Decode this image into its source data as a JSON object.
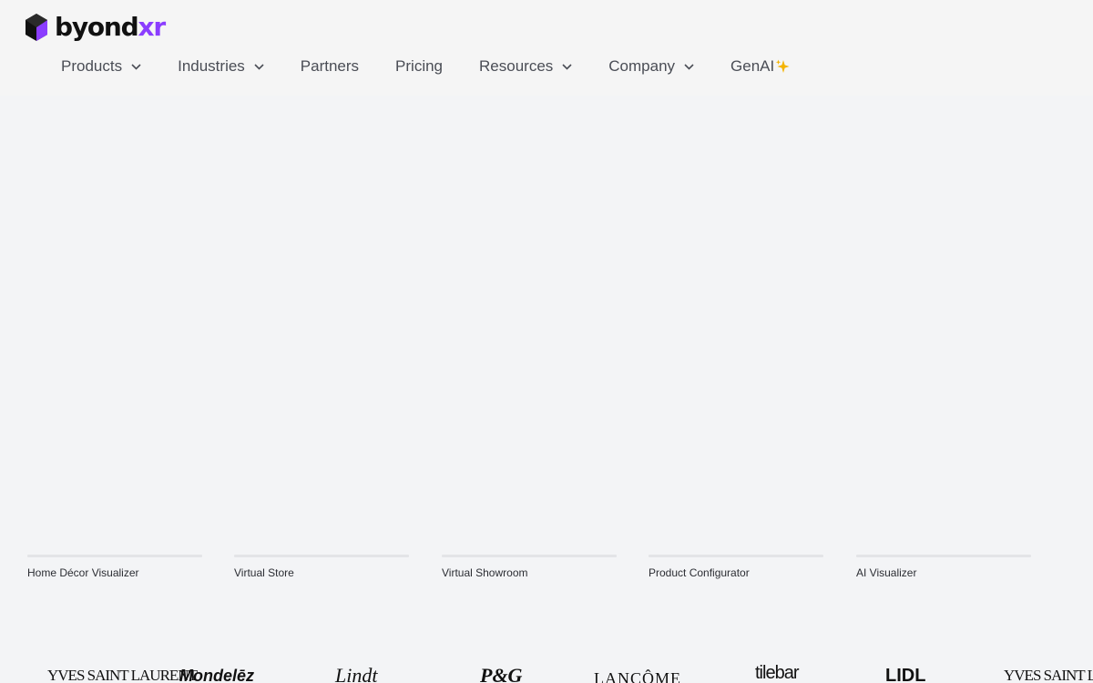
{
  "header": {
    "logo": {
      "text_dark": "byond",
      "text_accent": "xr",
      "accent_color": "#8b3dff"
    },
    "nav": [
      {
        "label": "Products",
        "has_dropdown": true,
        "icon": "chevron-down-icon"
      },
      {
        "label": "Industries",
        "has_dropdown": true,
        "icon": "chevron-down-icon"
      },
      {
        "label": "Partners",
        "has_dropdown": false
      },
      {
        "label": "Pricing",
        "has_dropdown": false
      },
      {
        "label": "Resources",
        "has_dropdown": true,
        "icon": "chevron-down-icon"
      },
      {
        "label": "Company",
        "has_dropdown": true,
        "icon": "chevron-down-icon"
      },
      {
        "label": "GenAI",
        "has_dropdown": false,
        "icon": "sparkles-icon"
      }
    ]
  },
  "products": [
    {
      "label": "Home Décor Visualizer"
    },
    {
      "label": "Virtual Store"
    },
    {
      "label": "Virtual Showroom"
    },
    {
      "label": "Product Configurator"
    },
    {
      "label": "AI Visualizer"
    }
  ],
  "brands": [
    "YVES SAINT LAURENT",
    "Mondelēz",
    "Lindt",
    "P&G",
    "LANCÔME",
    "tilebar",
    "LIDL",
    "YVES SAINT LAURENT"
  ]
}
